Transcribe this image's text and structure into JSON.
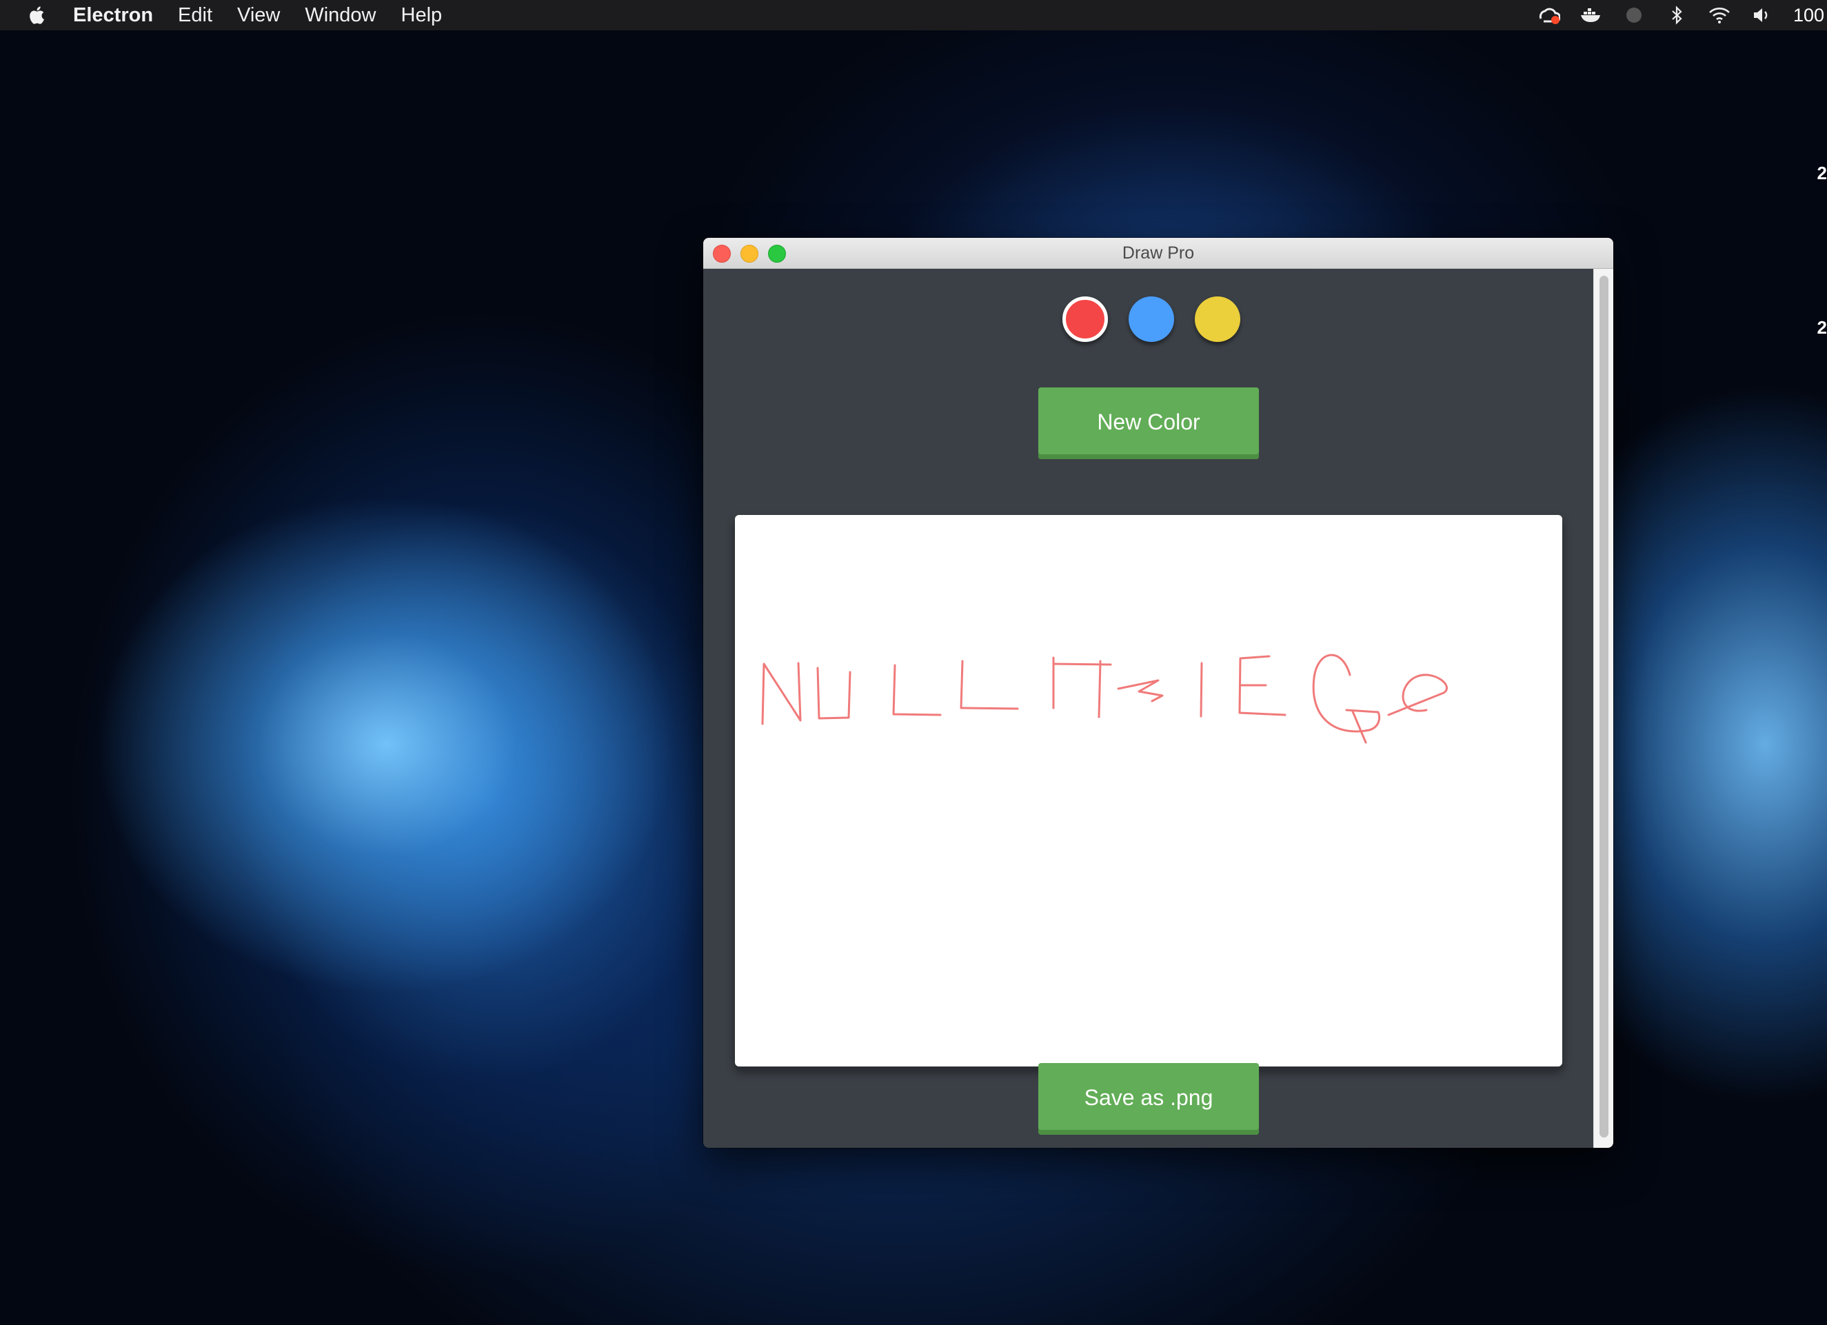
{
  "menubar": {
    "app_name": "Electron",
    "items": [
      "Edit",
      "View",
      "Window",
      "Help"
    ],
    "tray_text": "100",
    "tray_icons": [
      "creative-cloud-icon",
      "docker-icon",
      "circle-icon",
      "bluetooth-icon",
      "wifi-icon",
      "volume-icon"
    ]
  },
  "desktop": {
    "edge_numbers": [
      "2",
      "2"
    ]
  },
  "window": {
    "title": "Draw Pro"
  },
  "palette": {
    "colors": [
      {
        "name": "red",
        "hex": "#f44646",
        "selected": true
      },
      {
        "name": "blue",
        "hex": "#4a9efc",
        "selected": false
      },
      {
        "name": "yellow",
        "hex": "#ebcf3b",
        "selected": false
      }
    ]
  },
  "buttons": {
    "new_color": "New Color",
    "save": "Save as .png"
  },
  "drawing": {
    "stroke_color": "#f07a7a",
    "handwritten_text": "NULLTHICGe"
  }
}
